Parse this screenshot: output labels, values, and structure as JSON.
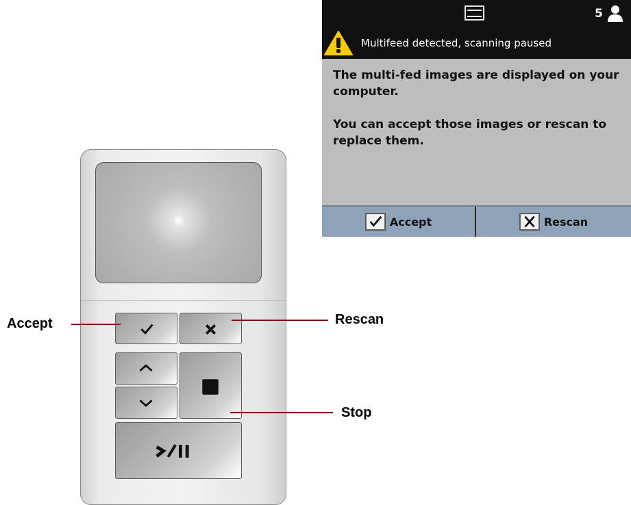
{
  "screen": {
    "user_count": "5",
    "warning_text": "Multifeed detected, scanning paused",
    "message_lines": [
      "The multi-fed images are displayed on your computer.",
      "You can accept those images or rescan to replace them."
    ],
    "accept_label": "Accept",
    "rescan_label": "Rescan"
  },
  "device": {
    "buttons": [
      "check-icon",
      "x-icon",
      "arrow-up-icon",
      "arrow-down-icon",
      "stop-icon",
      "play-pause-icon"
    ]
  },
  "callouts": {
    "accept": "Accept",
    "rescan": "Rescan",
    "stop": "Stop"
  },
  "colors": {
    "status_bar": "#111111",
    "screen_body": "#bdbdbd",
    "screen_buttons": "#8ea2b8",
    "warning": "#f5cc00",
    "leader_line": "#7a1114"
  }
}
